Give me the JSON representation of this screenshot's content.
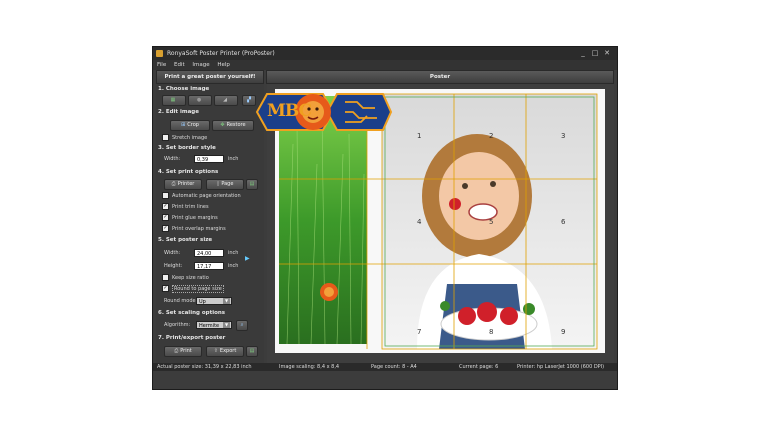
{
  "window": {
    "title": "RonyaSoft Poster Printer (ProPoster)",
    "controls": [
      "_",
      "□",
      "✕"
    ]
  },
  "menu": {
    "items": [
      "File",
      "Edit",
      "Image",
      "Help"
    ]
  },
  "headers": {
    "left": "Print a great poster yourself!",
    "right": "Poster"
  },
  "sections": {
    "choose_image": "1. Choose image",
    "edit_image": "2. Edit image",
    "border_style": "3. Set border style",
    "print_options": "4. Set print options",
    "poster_size": "5. Set poster size",
    "scaling": "6. Set scaling options",
    "print_export": "7. Print/export poster"
  },
  "edit": {
    "crop": "Crop",
    "restore": "Restore",
    "stretch": "Stretch image"
  },
  "border": {
    "width_label": "Width:",
    "width_value": "0,39",
    "unit": "inch"
  },
  "print_opts": {
    "printer": "Printer",
    "page": "Page",
    "auto_orient": "Automatic page orientation",
    "trim_lines": "Print trim lines",
    "glue_margins": "Print glue margins",
    "overlap_margins": "Print overlap margins"
  },
  "size": {
    "width_label": "Width:",
    "width_value": "24,00",
    "height_label": "Height:",
    "height_value": "17,17",
    "unit": "inch",
    "keep_ratio": "Keep size ratio",
    "round_page": "Round to page size",
    "round_mode_label": "Round mode:",
    "round_mode_value": "Up"
  },
  "scaling": {
    "algo_label": "Algorithm:",
    "algo_value": "Hermite"
  },
  "export": {
    "print": "Print",
    "export": "Export"
  },
  "tiles": [
    "1",
    "2",
    "3",
    "4",
    "5",
    "6",
    "7",
    "8",
    "9"
  ],
  "logo": {
    "text": "MBC"
  },
  "status": {
    "actual_size": "Actual poster size: 31,39 x 22,83 inch",
    "image_scaling": "Image scaling: 8,4 x 8,4",
    "page_count": "Page count: 8 - A4",
    "current_page": "Current page: 6",
    "printer": "Printer: hp LaserJet 1000 (600 DPI)"
  },
  "colors": {
    "accent": "#f0a020",
    "grid": "#e0a000",
    "window": "#3c3c3c"
  }
}
